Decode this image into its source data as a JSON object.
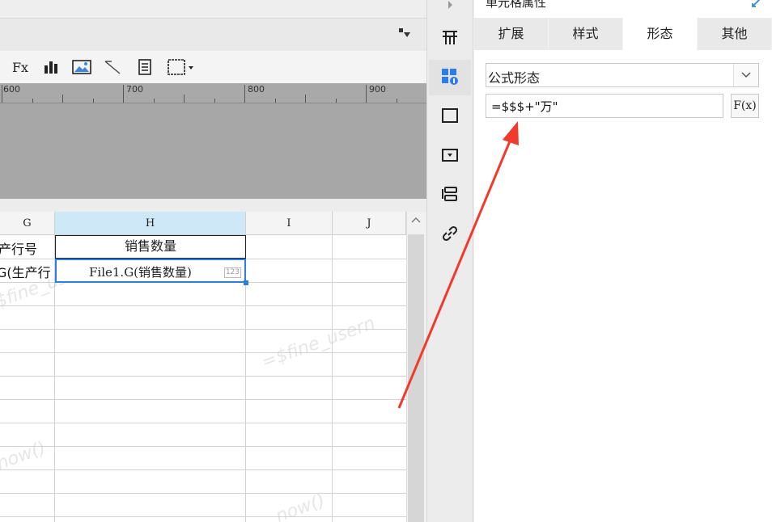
{
  "toolbar": {
    "formula_icon": "Fx"
  },
  "ruler": {
    "labels": [
      "600",
      "700",
      "800",
      "900"
    ]
  },
  "grid": {
    "columns": [
      "G",
      "H",
      "I",
      "J"
    ],
    "cells": {
      "g1": "产行号",
      "g2": "G(生产行",
      "h1": "销售数量",
      "h2": "File1.G(销售数量)",
      "h2_badge": "123"
    },
    "watermarks": [
      "$fine_username",
      "=$fine_usern",
      "now()",
      "now()"
    ]
  },
  "panel": {
    "title": "单元格属性",
    "tabs": [
      {
        "label": "扩展",
        "active": false
      },
      {
        "label": "样式",
        "active": false
      },
      {
        "label": "形态",
        "active": true
      },
      {
        "label": "其他",
        "active": false
      }
    ],
    "shape_select": {
      "value": "公式形态"
    },
    "formula": {
      "value": "=$$$+\"万\"",
      "button_label": "F(x)"
    }
  },
  "colors": {
    "accent": "#2b7de9",
    "annotation_arrow": "#f03a2e",
    "selected_header": "#cfe8f7"
  }
}
